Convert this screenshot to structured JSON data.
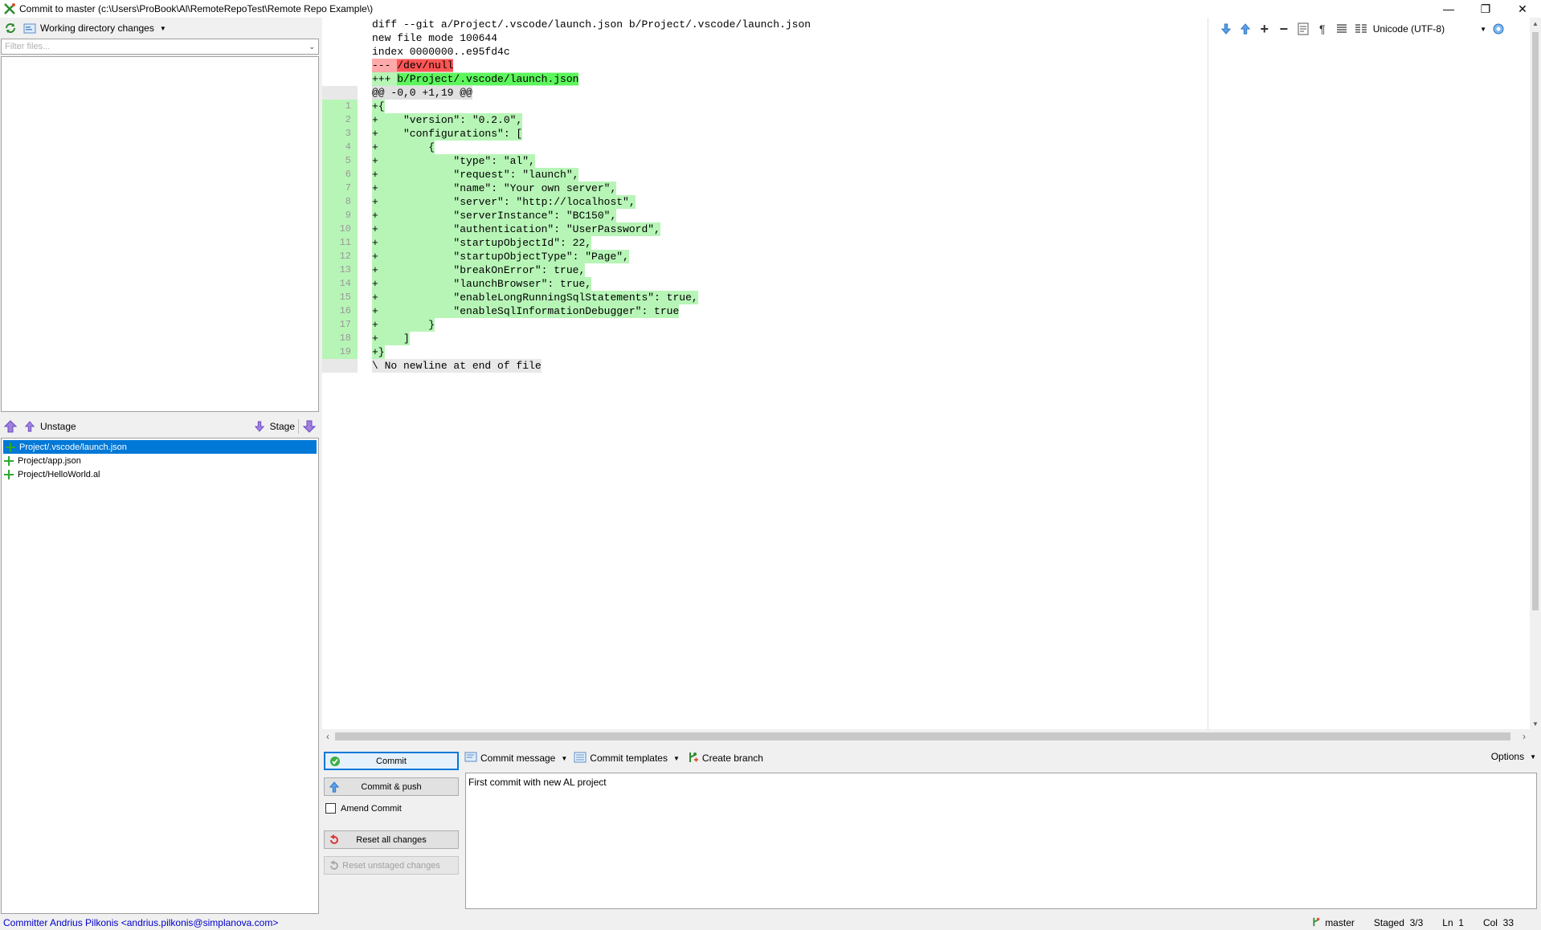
{
  "window": {
    "title": "Commit to master (c:\\Users\\ProBook\\Al\\RemoteRepoTest\\Remote Repo Example\\)"
  },
  "left_panel": {
    "workdir_label": "Working directory changes",
    "filter_placeholder": "Filter files..."
  },
  "stage_toolbar": {
    "unstage_label": "Unstage",
    "stage_label": "Stage"
  },
  "staged_files": [
    {
      "name": "Project/.vscode/launch.json",
      "selected": true
    },
    {
      "name": "Project/app.json",
      "selected": false
    },
    {
      "name": "Project/HelloWorld.al",
      "selected": false
    }
  ],
  "diff_toolbar": {
    "encoding": "Unicode (UTF-8)"
  },
  "diff": {
    "header": [
      "diff --git a/Project/.vscode/launch.json b/Project/.vscode/launch.json",
      "new file mode 100644",
      "index 0000000..e95fd4c"
    ],
    "minus_prefix": "--- ",
    "minus_path": "/dev/null",
    "plus_prefix": "+++ ",
    "plus_path": "b/Project/.vscode/launch.json",
    "hunk": "@@ -0,0 +1,19 @@",
    "lines": [
      {
        "n": "1",
        "t": "+{"
      },
      {
        "n": "2",
        "t": "+    \"version\": \"0.2.0\","
      },
      {
        "n": "3",
        "t": "+    \"configurations\": ["
      },
      {
        "n": "4",
        "t": "+        {"
      },
      {
        "n": "5",
        "t": "+            \"type\": \"al\","
      },
      {
        "n": "6",
        "t": "+            \"request\": \"launch\","
      },
      {
        "n": "7",
        "t": "+            \"name\": \"Your own server\","
      },
      {
        "n": "8",
        "t": "+            \"server\": \"http://localhost\","
      },
      {
        "n": "9",
        "t": "+            \"serverInstance\": \"BC150\","
      },
      {
        "n": "10",
        "t": "+            \"authentication\": \"UserPassword\","
      },
      {
        "n": "11",
        "t": "+            \"startupObjectId\": 22,"
      },
      {
        "n": "12",
        "t": "+            \"startupObjectType\": \"Page\","
      },
      {
        "n": "13",
        "t": "+            \"breakOnError\": true,"
      },
      {
        "n": "14",
        "t": "+            \"launchBrowser\": true,"
      },
      {
        "n": "15",
        "t": "+            \"enableLongRunningSqlStatements\": true,"
      },
      {
        "n": "16",
        "t": "+            \"enableSqlInformationDebugger\": true"
      },
      {
        "n": "17",
        "t": "+        }"
      },
      {
        "n": "18",
        "t": "+    ]"
      },
      {
        "n": "19",
        "t": "+}"
      }
    ],
    "no_newline": "\\ No newline at end of file"
  },
  "commit_buttons": {
    "commit": "Commit",
    "commit_push": "Commit & push",
    "amend": "Amend Commit",
    "reset_all": "Reset all changes",
    "reset_unstaged": "Reset unstaged changes"
  },
  "commit_toolbar": {
    "commit_message": "Commit message",
    "commit_templates": "Commit templates",
    "create_branch": "Create branch",
    "options": "Options"
  },
  "commit_message_text": "First commit with new AL project",
  "status_bar": {
    "committer": "Committer Andrius Pilkonis <andrius.pilkonis@simplanova.com>",
    "branch": "master",
    "staged": "Staged  3/3",
    "line": "Ln  1",
    "col": "Col  33"
  }
}
